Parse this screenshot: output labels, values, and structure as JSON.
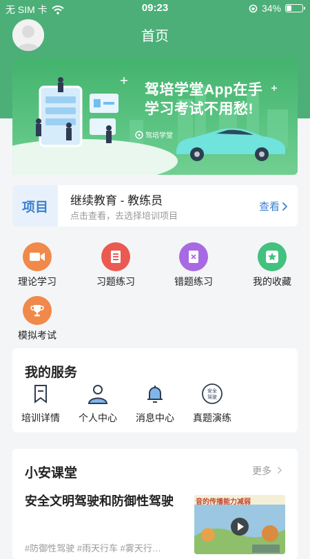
{
  "status_bar": {
    "carrier": "无 SIM 卡",
    "time": "09:23",
    "battery": "34%",
    "battery_level": 0.34
  },
  "header": {
    "title": "首页"
  },
  "banner": {
    "slogan_line1": "驾培学堂App在手",
    "slogan_line2": "学习考试不用愁!",
    "logo_text": "驾培学堂"
  },
  "project": {
    "tag": "项目",
    "name": "继续教育 - 教练员",
    "hint": "点击查看，去选择培训项目",
    "view_label": "查看"
  },
  "features": [
    {
      "label": "理论学习",
      "icon": "video-icon",
      "color": "#f0894a"
    },
    {
      "label": "习题练习",
      "icon": "document-icon",
      "color": "#ea5a52"
    },
    {
      "label": "错题练习",
      "icon": "wrong-doc-icon",
      "color": "#a86ae3"
    },
    {
      "label": "我的收藏",
      "icon": "star-icon",
      "color": "#43c17f"
    },
    {
      "label": "模拟考试",
      "icon": "trophy-icon",
      "color": "#f0894a"
    }
  ],
  "services": {
    "title": "我的服务",
    "items": [
      {
        "label": "培训详情",
        "icon": "bookmark-icon"
      },
      {
        "label": "个人中心",
        "icon": "user-icon"
      },
      {
        "label": "消息中心",
        "icon": "bell-icon"
      },
      {
        "label": "真题演练",
        "icon": "safety-badge-icon",
        "badge_line1": "安全",
        "badge_line2": "驾驶"
      }
    ]
  },
  "classroom": {
    "title": "小安课堂",
    "more_label": "更多",
    "lesson": {
      "title": "安全文明驾驶和防御性驾驶",
      "tags": "#防御性驾驶  #雨天行车  #雾天行…",
      "thumb_caption": "音的传播能力减弱"
    }
  }
}
